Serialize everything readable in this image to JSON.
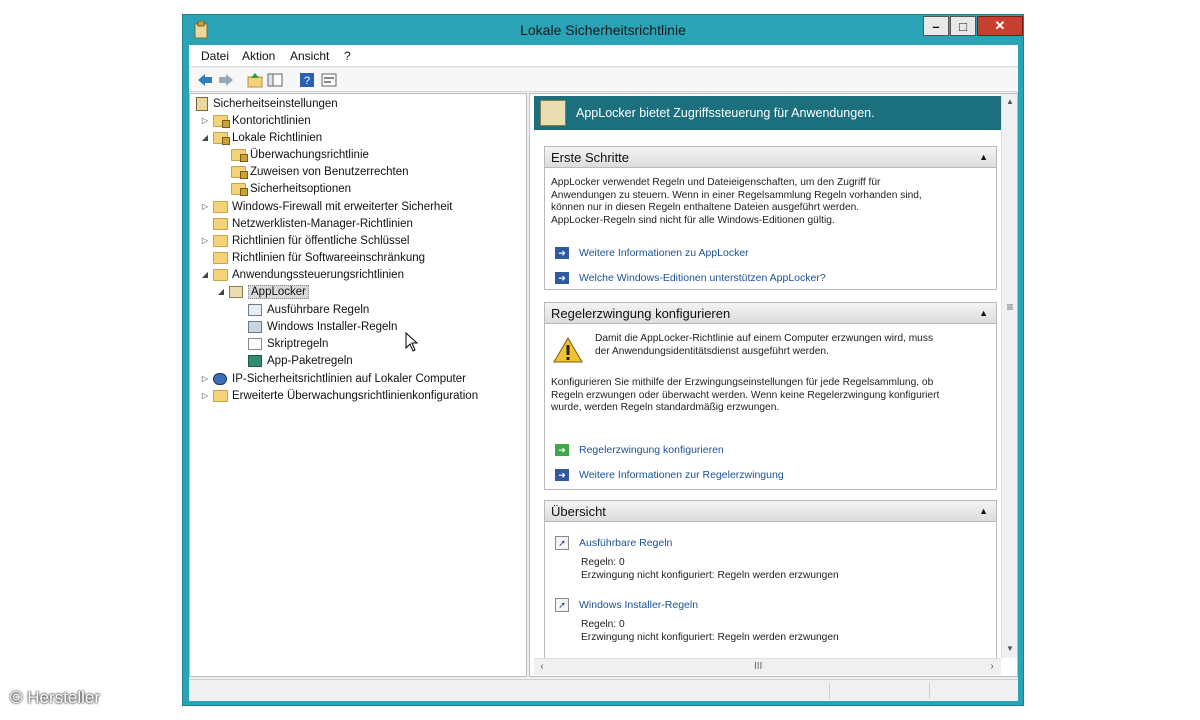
{
  "window": {
    "title": "Lokale Sicherheitsrichtlinie",
    "controls": {
      "minimize": "–",
      "maximize": "□",
      "close": "✕"
    }
  },
  "menu": [
    "Datei",
    "Aktion",
    "Ansicht",
    "?"
  ],
  "toolbar": [
    "back-arrow-icon",
    "forward-arrow-icon",
    "up-folder-icon",
    "show-hide-tree-icon",
    "help-icon",
    "properties-icon"
  ],
  "tree": {
    "root": "Sicherheitseinstellungen",
    "items": [
      {
        "label": "Kontorichtlinien"
      },
      {
        "label": "Lokale Richtlinien"
      },
      {
        "label": "Überwachungsrichtlinie"
      },
      {
        "label": "Zuweisen von Benutzerrechten"
      },
      {
        "label": "Sicherheitsoptionen"
      },
      {
        "label": "Windows-Firewall mit erweiterter Sicherheit"
      },
      {
        "label": "Netzwerklisten-Manager-Richtlinien"
      },
      {
        "label": "Richtlinien für öffentliche Schlüssel"
      },
      {
        "label": "Richtlinien für Softwareeinschränkung"
      },
      {
        "label": "Anwendungssteuerungsrichtlinien"
      },
      {
        "label": "AppLocker"
      },
      {
        "label": "Ausführbare Regeln"
      },
      {
        "label": "Windows Installer-Regeln"
      },
      {
        "label": "Skriptregeln"
      },
      {
        "label": "App-Paketregeln"
      },
      {
        "label": "IP-Sicherheitsrichtlinien auf Lokaler Computer"
      },
      {
        "label": "Erweiterte Überwachungsrichtlinienkonfiguration"
      }
    ]
  },
  "banner": {
    "text": "AppLocker bietet Zugriffssteuerung für Anwendungen."
  },
  "sections": {
    "getting_started": {
      "title": "Erste Schritte",
      "body": [
        "AppLocker verwendet Regeln und Dateieigenschaften, um den Zugriff für",
        "Anwendungen zu steuern. Wenn in einer Regelsammlung Regeln vorhanden sind,",
        "können nur in diesen Regeln enthaltene Dateien ausgeführt werden.",
        "AppLocker-Regeln sind nicht für alle Windows-Editionen gültig."
      ],
      "links": [
        "Weitere Informationen zu AppLocker",
        "Welche Windows-Editionen unterstützen AppLocker?"
      ]
    },
    "enforcement": {
      "title": "Regelerzwingung konfigurieren",
      "warning": [
        "Damit die AppLocker-Richtlinie auf einem Computer erzwungen wird, muss",
        "der Anwendungsidentitätsdienst ausgeführt werden."
      ],
      "body": [
        "Konfigurieren Sie mithilfe der Erzwingungseinstellungen für jede Regelsammlung, ob",
        "Regeln erzwungen oder überwacht werden. Wenn keine Regelerzwingung konfiguriert",
        "wurde, werden Regeln standardmäßig erzwungen."
      ],
      "links": [
        "Regelerzwingung konfigurieren",
        "Weitere Informationen zur Regelerzwingung"
      ]
    },
    "overview": {
      "title": "Übersicht",
      "items": [
        {
          "name": "Ausführbare Regeln",
          "rules": "Regeln: 0",
          "status": "Erzwingung nicht konfiguriert: Regeln werden erzwungen"
        },
        {
          "name": "Windows Installer-Regeln",
          "rules": "Regeln: 0",
          "status": "Erzwingung nicht konfiguriert: Regeln werden erzwungen"
        }
      ]
    }
  },
  "scrollbar": {
    "grip": "≡",
    "h_grip": "III"
  },
  "copyright": "© Hersteller"
}
